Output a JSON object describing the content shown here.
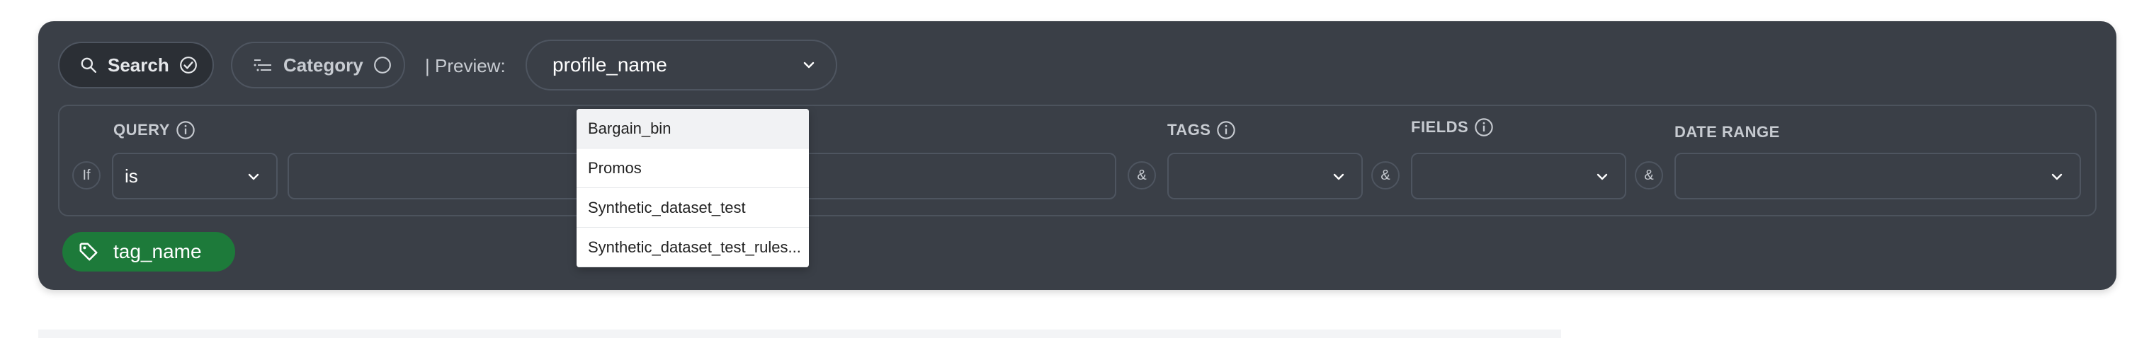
{
  "toolbar": {
    "search_label": "Search",
    "category_label": "Category",
    "preview_label": "| Preview:",
    "preview_value": "profile_name"
  },
  "query": {
    "label": "QUERY",
    "if_label": "If",
    "operator": "is",
    "value": ""
  },
  "tags": {
    "label": "TAGS",
    "value": ""
  },
  "fields": {
    "label": "FIELDS",
    "value": ""
  },
  "date_range": {
    "label": "DATE RANGE",
    "value": ""
  },
  "connector": "&",
  "tag_chip": {
    "label": "tag_name",
    "color": "#1d7a3a"
  },
  "dropdown": {
    "options": [
      "Bargain_bin",
      "Promos",
      "Synthetic_dataset_test",
      "Synthetic_dataset_test_rules..."
    ],
    "highlighted_index": 0
  },
  "colors": {
    "panel_bg": "#3a3f47",
    "pill_active_bg": "#2b2f35",
    "tag_green": "#1d7a3a"
  }
}
